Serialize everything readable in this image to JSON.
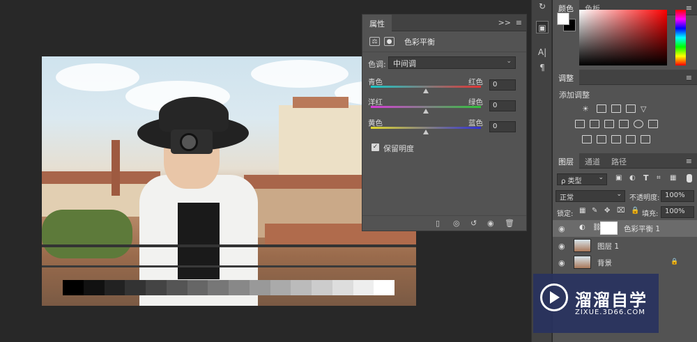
{
  "properties_panel": {
    "tab_label": "属性",
    "expand_glyph": ">>",
    "menu_glyph": "≡",
    "adjustment_name": "色彩平衡",
    "tone_label": "色调:",
    "tone_value": "中间调",
    "sliders": [
      {
        "left": "青色",
        "right": "红色",
        "value": "0",
        "level": 0.5
      },
      {
        "left": "洋红",
        "right": "绿色",
        "value": "0",
        "level": 0.5
      },
      {
        "left": "黄色",
        "right": "蓝色",
        "value": "0",
        "level": 0.5
      }
    ],
    "preserve_luminosity_label": "保留明度",
    "preserve_luminosity_checked": true
  },
  "color_panel": {
    "tab_color": "颜色",
    "tab_swatches": "色板"
  },
  "adjustments_panel": {
    "tab_label": "调整",
    "add_label": "添加调整"
  },
  "layers_panel": {
    "tabs": [
      "图层",
      "通道",
      "路径"
    ],
    "filter_label": "ρ 类型",
    "blend_mode": "正常",
    "opacity_label": "不透明度:",
    "opacity_value": "100%",
    "lock_label": "锁定:",
    "fill_label": "填充:",
    "fill_value": "100%",
    "layers": [
      {
        "name": "色彩平衡 1",
        "type": "adjustment"
      },
      {
        "name": "图层 1",
        "type": "image"
      },
      {
        "name": "背景",
        "type": "background"
      }
    ]
  },
  "side_toolbar": {
    "text_glyph": "A|",
    "paragraph_glyph": "¶"
  },
  "watermark": {
    "title": "溜溜自学",
    "url": "ZIXUE.3D66.COM"
  },
  "colors": {
    "workspace_bg": "#282828",
    "panel_bg": "#535353",
    "panel_tab_bg": "#424242",
    "watermark_bg": "#28325f"
  }
}
